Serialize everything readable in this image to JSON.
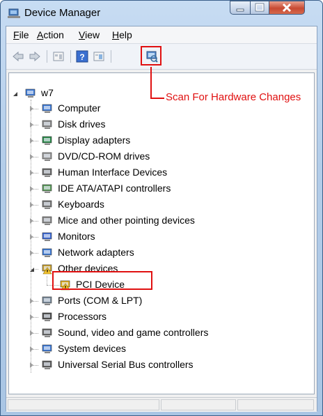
{
  "window": {
    "title": "Device Manager"
  },
  "menu": {
    "items": [
      "File",
      "Action",
      "View",
      "Help"
    ],
    "mnemonics": [
      "F",
      "A",
      "V",
      "H"
    ]
  },
  "toolbar": {
    "buttons": [
      "back-arrow-icon",
      "forward-arrow-icon",
      "properties-icon",
      "help-icon",
      "update-driver-icon",
      "scan-hardware-icon"
    ]
  },
  "annotation": {
    "scan": "Scan For Hardware Changes"
  },
  "tree": {
    "root": "w7",
    "categories": [
      {
        "label": "Computer",
        "icon": "computer-icon",
        "expanded": false
      },
      {
        "label": "Disk drives",
        "icon": "disk-drive-icon",
        "expanded": false
      },
      {
        "label": "Display adapters",
        "icon": "display-adapter-icon",
        "expanded": false
      },
      {
        "label": "DVD/CD-ROM drives",
        "icon": "dvd-drive-icon",
        "expanded": false
      },
      {
        "label": "Human Interface Devices",
        "icon": "hid-icon",
        "expanded": false
      },
      {
        "label": "IDE ATA/ATAPI controllers",
        "icon": "ide-controller-icon",
        "expanded": false
      },
      {
        "label": "Keyboards",
        "icon": "keyboard-icon",
        "expanded": false
      },
      {
        "label": "Mice and other pointing devices",
        "icon": "mouse-icon",
        "expanded": false
      },
      {
        "label": "Monitors",
        "icon": "monitor-icon",
        "expanded": false
      },
      {
        "label": "Network adapters",
        "icon": "network-adapter-icon",
        "expanded": false
      },
      {
        "label": "Other devices",
        "icon": "unknown-device-icon",
        "expanded": true
      },
      {
        "label": "Ports (COM & LPT)",
        "icon": "port-icon",
        "expanded": false
      },
      {
        "label": "Processors",
        "icon": "processor-icon",
        "expanded": false
      },
      {
        "label": "Sound, video and game controllers",
        "icon": "sound-icon",
        "expanded": false
      },
      {
        "label": "System devices",
        "icon": "system-device-icon",
        "expanded": false
      },
      {
        "label": "Universal Serial Bus controllers",
        "icon": "usb-icon",
        "expanded": false
      }
    ],
    "other_devices_children": [
      {
        "label": "PCI Device",
        "icon": "warning-device-icon"
      }
    ]
  },
  "colors": {
    "annotation": "#e01010",
    "title_bar": "#b3cde9",
    "close_button": "#c74a32"
  }
}
